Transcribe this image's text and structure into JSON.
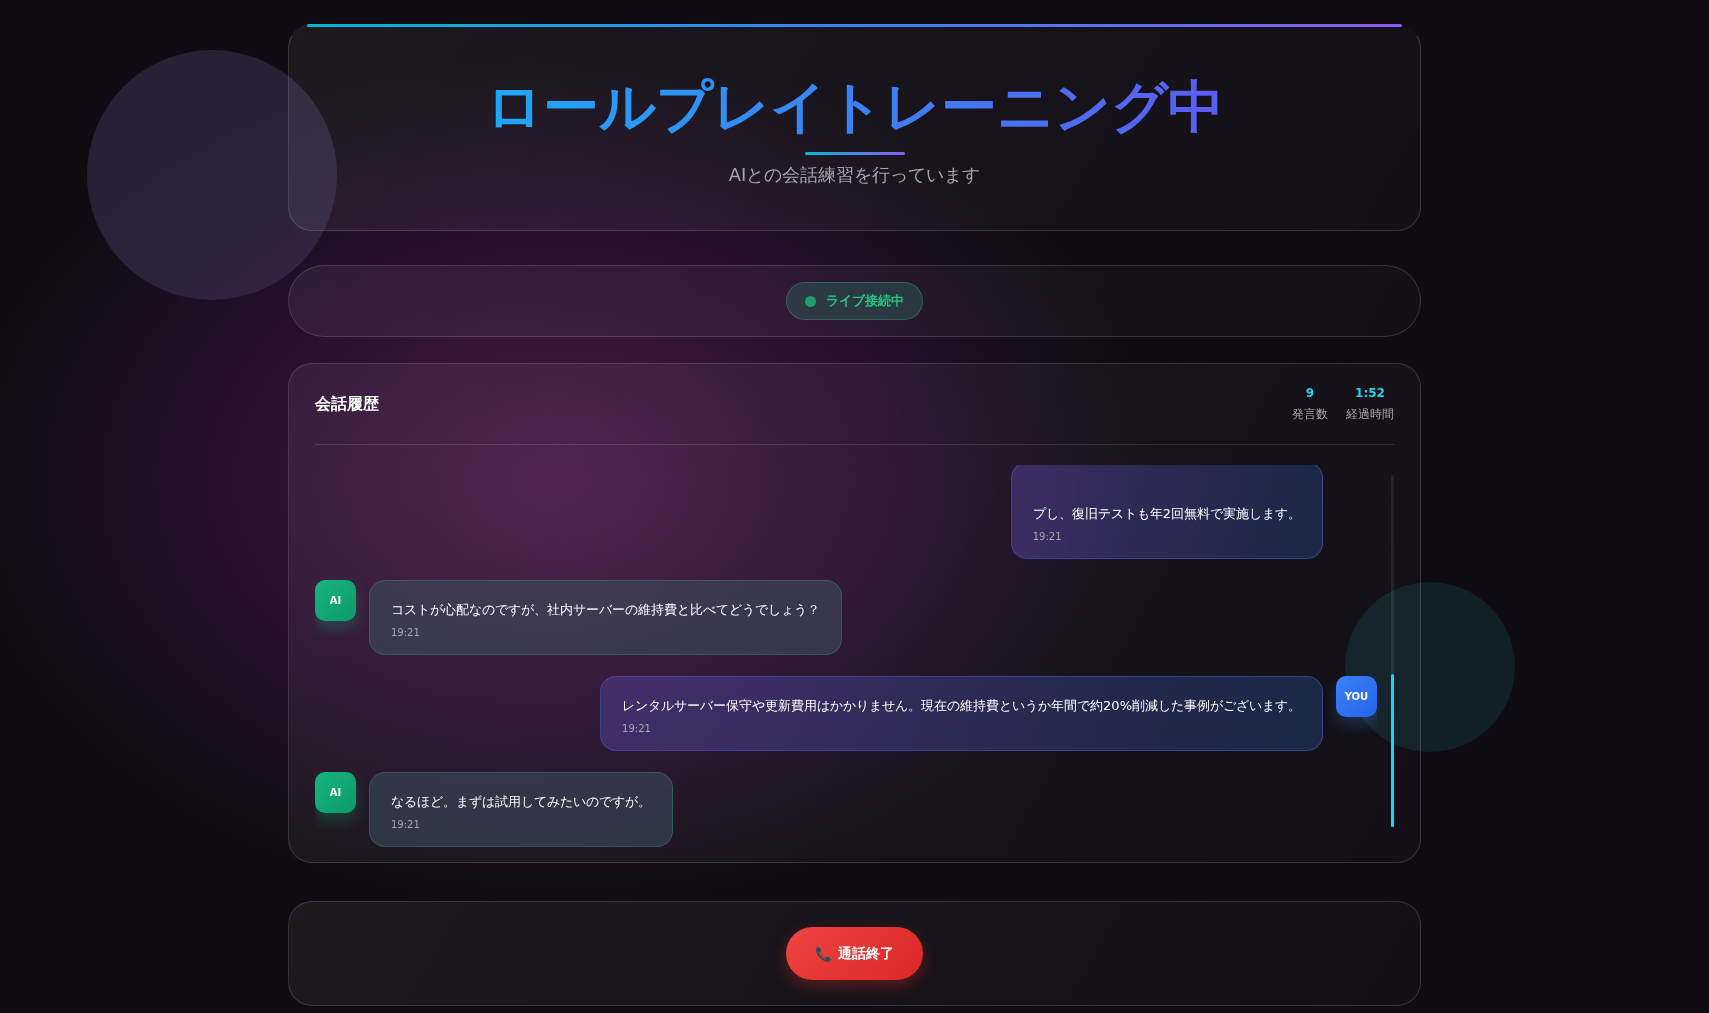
{
  "header": {
    "title": "ロールプレイトレーニング中",
    "subtitle": "AIとの会話練習を行っています"
  },
  "status": {
    "label": "ライブ接続中",
    "connected": true
  },
  "conversation": {
    "title": "会話履歴",
    "stats": [
      {
        "value": "9",
        "label": "発言数"
      },
      {
        "value": "1:52",
        "label": "経過時間"
      }
    ],
    "messages": [
      {
        "kind": "user",
        "text": "プし、復旧テストも年2回無料で実施します。",
        "time": "19:21"
      },
      {
        "kind": "ai",
        "avatar": "AI",
        "text": "コストが心配なのですが、社内サーバーの維持費と比べてどうでしょう？",
        "time": "19:21"
      },
      {
        "kind": "user",
        "avatar": "YOU",
        "text": "レンタルサーバー保守や更新費用はかかりません。現在の維持費というか年間で約20%削減した事例がございます。",
        "time": "19:21"
      },
      {
        "kind": "ai",
        "avatar": "AI",
        "text": "なるほど。まずは試用してみたいのですが。",
        "time": "19:21"
      }
    ]
  },
  "end_call_button": {
    "icon": "📞",
    "label": "通話終了"
  }
}
